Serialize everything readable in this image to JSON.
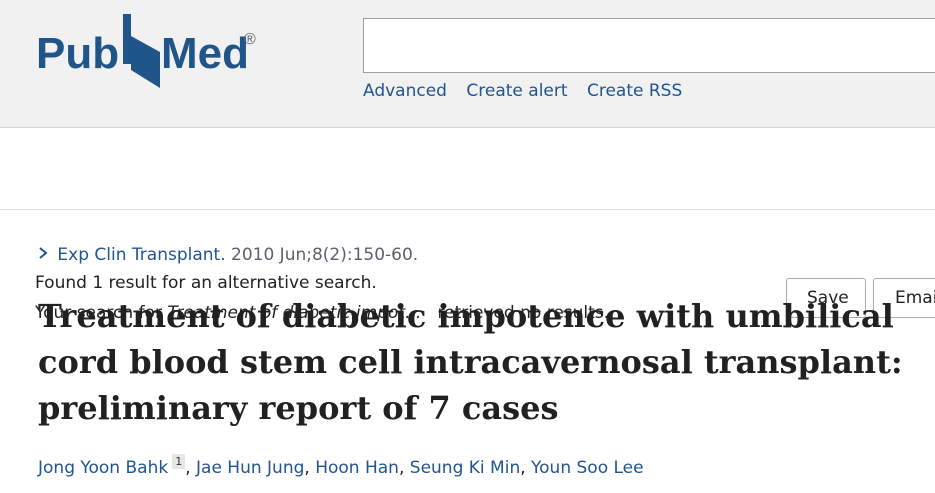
{
  "header": {
    "logo": {
      "text_left": "Pub",
      "text_right": "Med",
      "registered": "®"
    },
    "search": {
      "value": "",
      "placeholder": ""
    },
    "links": [
      "Advanced",
      "Create alert",
      "Create RSS"
    ]
  },
  "notice": {
    "line1": "Found 1 result for an alternative search.",
    "line2_prefix": "Your search for ",
    "line2_query": "Treatment of diabetic impot...",
    "line2_suffix": "retrieved no results."
  },
  "actions": {
    "save": "Save",
    "email": "Email"
  },
  "article": {
    "journal": "Exp Clin Transplant.",
    "date": "2010 Jun;8(2):150-60.",
    "title": "Treatment of diabetic impotence with umbilical cord blood stem cell intracavernosal transplant: preliminary report of 7 cases",
    "authors": [
      {
        "name": "Jong Yoon Bahk",
        "affiliation": "1"
      },
      {
        "name": "Jae Hun Jung"
      },
      {
        "name": "Hoon Han"
      },
      {
        "name": "Seung Ki Min"
      },
      {
        "name": "Youn Soo Lee"
      }
    ]
  },
  "colors": {
    "link": "#205493",
    "brand_blue": "#20558a",
    "header_bg": "#f1f1f1"
  },
  "icons": {
    "citation_chevron": "chevron-right-icon"
  }
}
